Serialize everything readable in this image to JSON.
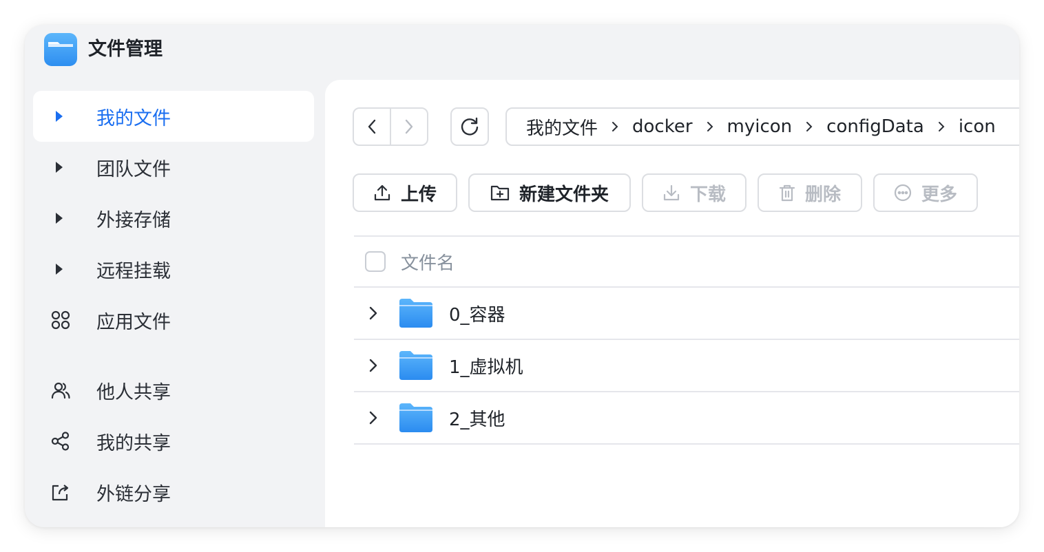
{
  "app": {
    "title": "文件管理",
    "icon": "folder-app-icon"
  },
  "sidebar": {
    "items": [
      {
        "label": "我的文件",
        "icon": "triangle-right-icon",
        "active": true
      },
      {
        "label": "团队文件",
        "icon": "triangle-right-icon"
      },
      {
        "label": "外接存储",
        "icon": "triangle-right-icon"
      },
      {
        "label": "远程挂载",
        "icon": "triangle-right-icon"
      },
      {
        "label": "应用文件",
        "icon": "apps-grid-icon"
      },
      {
        "label": "他人共享",
        "icon": "users-icon"
      },
      {
        "label": "我的共享",
        "icon": "share-icon"
      },
      {
        "label": "外链分享",
        "icon": "external-link-icon"
      }
    ]
  },
  "breadcrumb": [
    "我的文件",
    "docker",
    "myicon",
    "configData",
    "icon"
  ],
  "toolbar": {
    "upload": "上传",
    "new_folder": "新建文件夹",
    "download": "下载",
    "delete": "删除",
    "more": "更多"
  },
  "table": {
    "header_name": "文件名",
    "rows": [
      {
        "name": "0_容器"
      },
      {
        "name": "1_虚拟机"
      },
      {
        "name": "2_其他"
      }
    ]
  },
  "colors": {
    "accent": "#1a6ef0",
    "folder": "#3aa0f5",
    "disabled": "#b8bcc3",
    "sidebar_bg": "#f2f3f5"
  }
}
